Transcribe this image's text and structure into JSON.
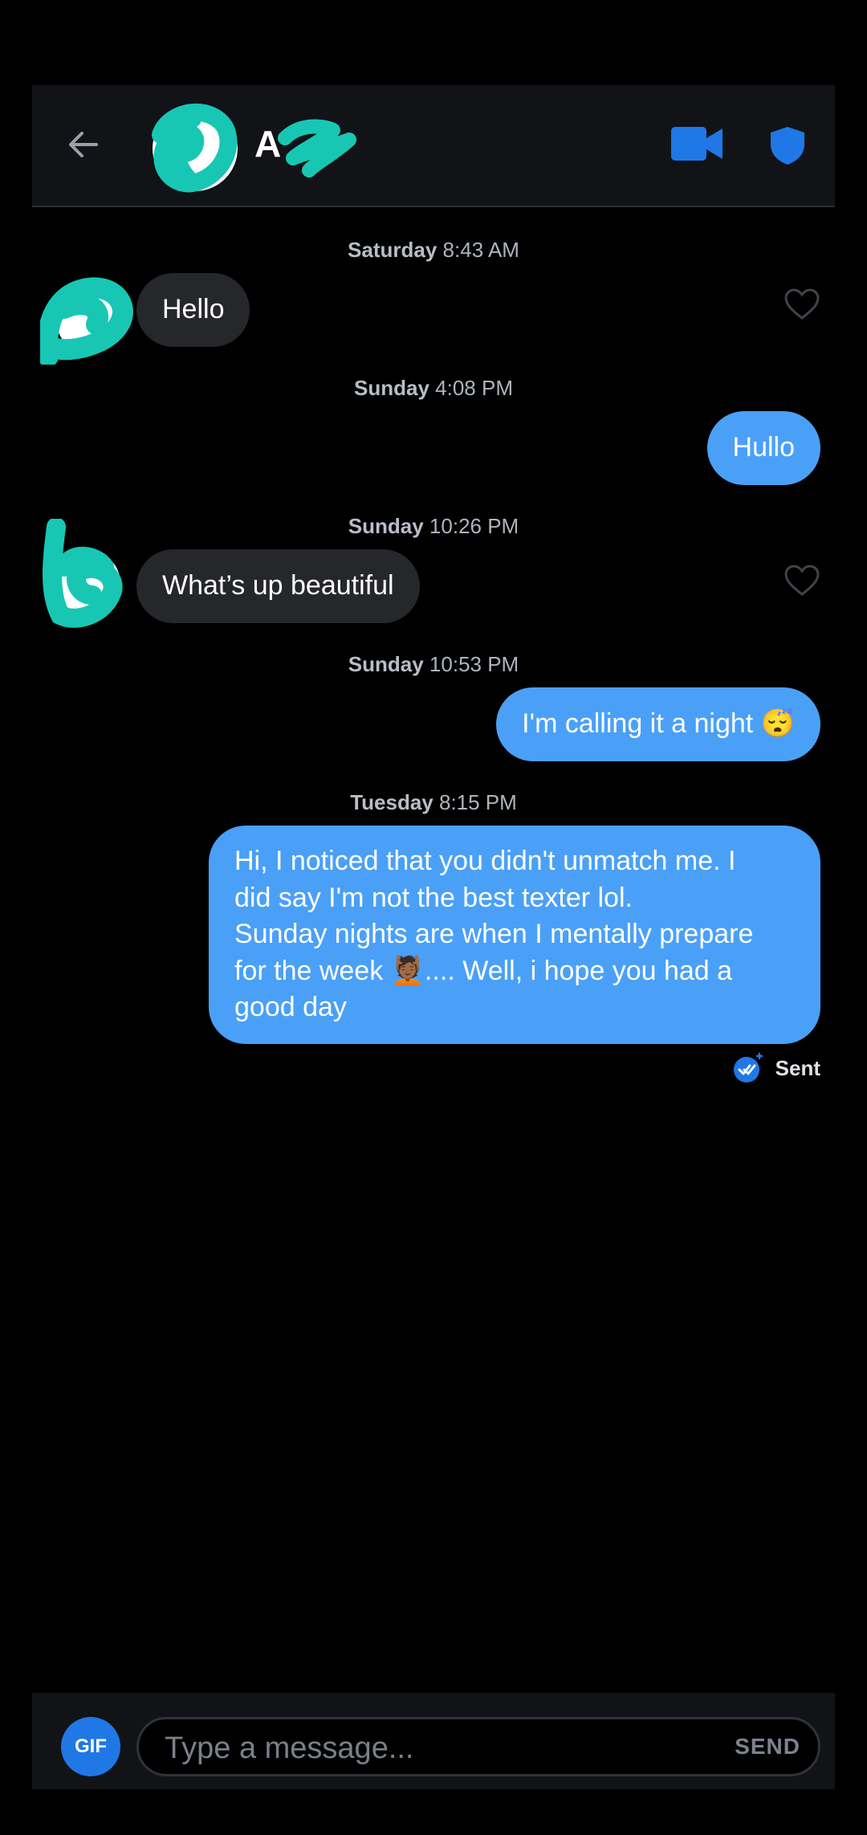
{
  "header": {
    "back_icon": "arrow-left-icon",
    "contact_initial": "A",
    "video_icon": "video-camera-icon",
    "shield_icon": "shield-icon",
    "accent_color": "#1f78e6"
  },
  "messages": [
    {
      "type": "timestamp",
      "day": "Saturday",
      "time": "8:43 AM"
    },
    {
      "type": "incoming",
      "text": "Hello"
    },
    {
      "type": "timestamp",
      "day": "Sunday",
      "time": "4:08 PM"
    },
    {
      "type": "outgoing",
      "text": "Hullo"
    },
    {
      "type": "timestamp",
      "day": "Sunday",
      "time": "10:26 PM"
    },
    {
      "type": "incoming",
      "text": "What’s up beautiful"
    },
    {
      "type": "timestamp",
      "day": "Sunday",
      "time": "10:53 PM"
    },
    {
      "type": "outgoing",
      "text": "I'm calling it a night 😴"
    },
    {
      "type": "timestamp",
      "day": "Tuesday",
      "time": "8:15 PM"
    },
    {
      "type": "outgoing",
      "lines": [
        "Hi, I noticed that you didn't unmatch me. I",
        "did say I'm not the best texter lol.",
        "Sunday nights are when I mentally prepare",
        "for the week 💆🏾.... Well, i hope you had a",
        "good day"
      ]
    }
  ],
  "status": {
    "label": "Sent",
    "icon": "double-check-icon"
  },
  "composer": {
    "gif_label": "GIF",
    "placeholder": "Type a message...",
    "send_label": "SEND"
  },
  "colors": {
    "outgoing_bubble": "#4aa0f7",
    "incoming_bubble": "#25272b",
    "background": "#000000"
  }
}
